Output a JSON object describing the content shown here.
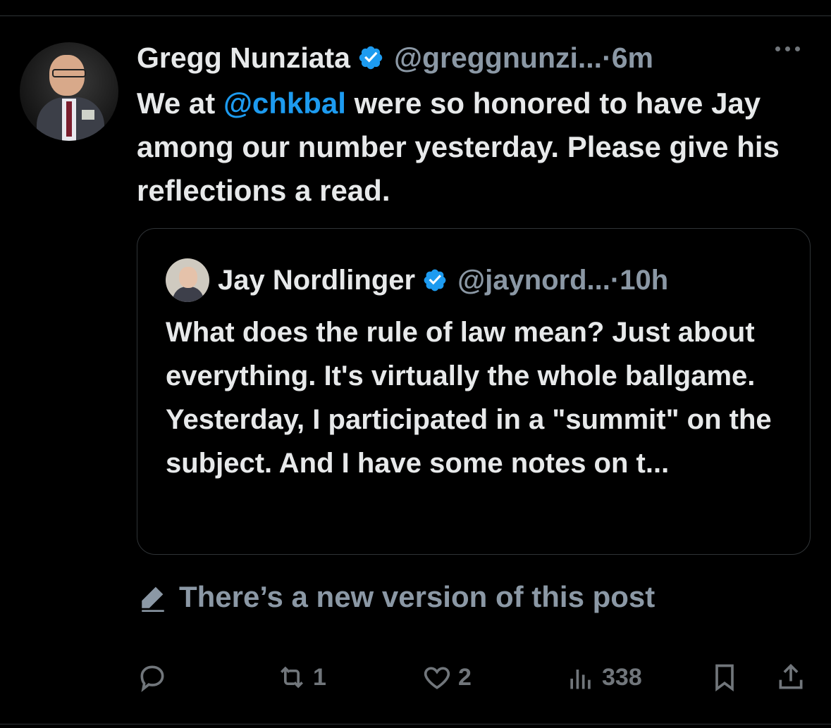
{
  "post": {
    "author_name": "Gregg Nunziata",
    "handle": "@greggnunzi...",
    "time": "·6m",
    "text_before": "We at ",
    "mention": "@chkbal",
    "text_after": " were so honored to have Jay among our number yesterday. Please give his reflections a read."
  },
  "quote": {
    "author_name": "Jay Nordlinger",
    "handle": "@jaynord...",
    "time": "·10h",
    "text": "What does the rule of law mean? Just about everything. It's virtually the whole ballgame. Yesterday, I participated in a \"summit\" on the subject. And I have some notes on t..."
  },
  "notice": {
    "new_version_text": "There’s a new version of this post"
  },
  "actions": {
    "reply_count": "",
    "repost_count": "1",
    "like_count": "2",
    "views_count": "338"
  },
  "colors": {
    "background": "#000000",
    "text": "#e7e9ea",
    "secondary": "#8b98a5",
    "accent": "#1d9bf0"
  },
  "icons": [
    "verified-badge-icon",
    "more-icon",
    "edit-pencil-icon",
    "reply-icon",
    "repost-icon",
    "like-icon",
    "views-icon",
    "bookmark-icon",
    "share-icon"
  ]
}
